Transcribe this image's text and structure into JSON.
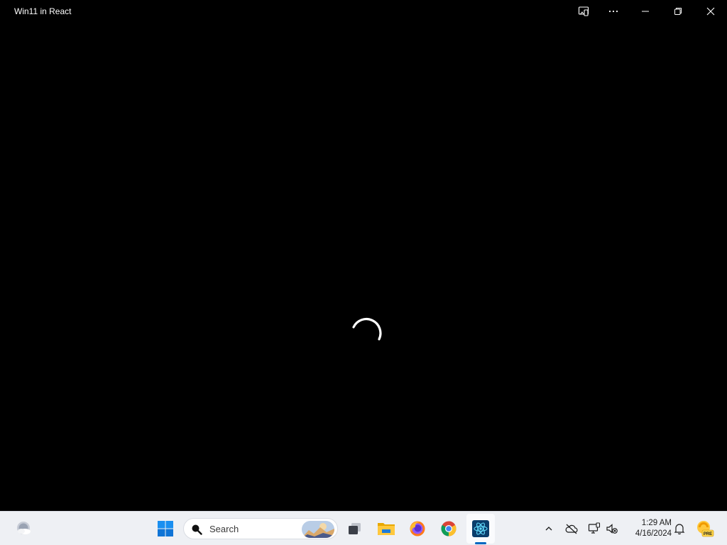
{
  "window": {
    "title": "Win11 in React",
    "controls": [
      "cast-icon",
      "more-icon",
      "minimize-icon",
      "restore-icon",
      "close-icon"
    ]
  },
  "content": {
    "state": "loading",
    "spinner_icon": "loading-spinner-icon"
  },
  "taskbar": {
    "widgets_icon": "weather-widget-icon",
    "start_icon": "windows-start-icon",
    "search": {
      "placeholder": "Search"
    },
    "apps": [
      {
        "name": "task-view",
        "icon": "task-view-icon"
      },
      {
        "name": "file-explorer",
        "icon": "folder-icon"
      },
      {
        "name": "firefox",
        "icon": "firefox-icon"
      },
      {
        "name": "chrome",
        "icon": "chrome-icon"
      },
      {
        "name": "react-app",
        "icon": "react-icon",
        "active": true
      }
    ],
    "tray": {
      "icons": [
        "chevron-up-icon",
        "onedrive-offline-icon",
        "display-icon",
        "volume-muted-icon"
      ],
      "time": "1:29 AM",
      "date": "4/16/2024",
      "notification_icon": "bell-icon",
      "badge_icon": "pre-badge-icon",
      "badge_text": "PRE"
    }
  },
  "colors": {
    "accent": "#0067c0",
    "background": "#000000",
    "taskbar": "#eef0f4"
  }
}
